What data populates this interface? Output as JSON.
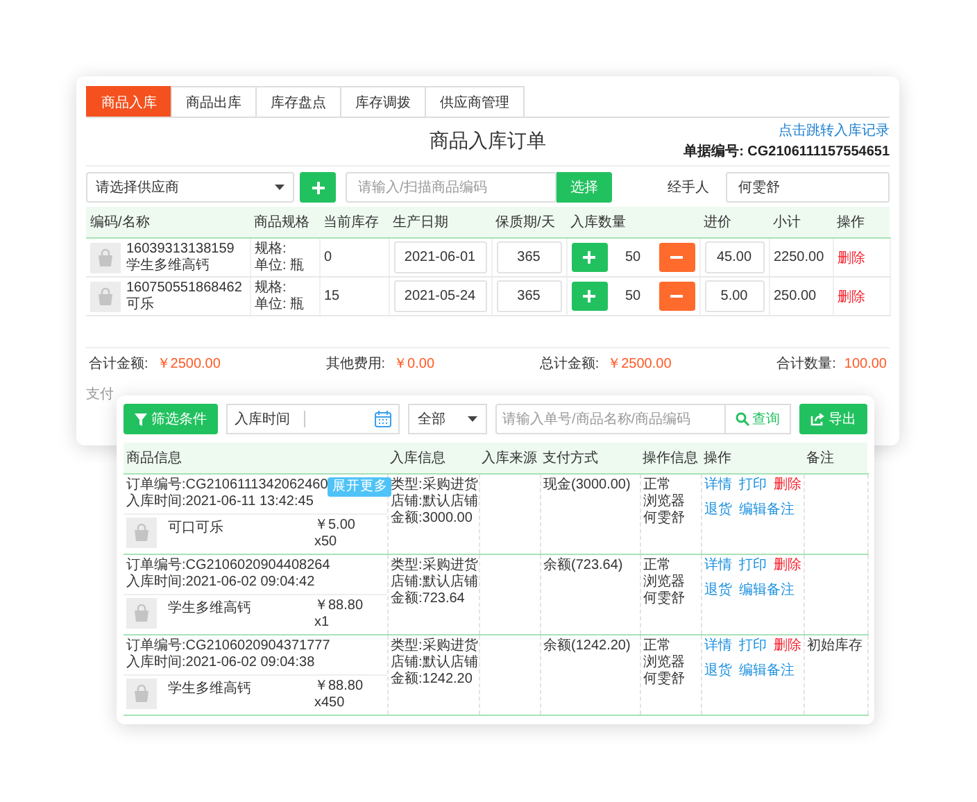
{
  "tabs": [
    {
      "label": "商品入库",
      "selected": true
    },
    {
      "label": "商品出库",
      "selected": false
    },
    {
      "label": "库存盘点",
      "selected": false
    },
    {
      "label": "库存调拨",
      "selected": false
    },
    {
      "label": "供应商管理",
      "selected": false
    }
  ],
  "form": {
    "title": "商品入库订单",
    "record_link": "点击跳转入库记录",
    "document_number": "单据编号: CG2106111157554651",
    "supplier_select": {
      "placeholder": "请选择供应商"
    },
    "code_input": {
      "placeholder": "请输入/扫描商品编码"
    },
    "select_button": "选择",
    "handler_label": "经手人",
    "handler_value": "何雯舒"
  },
  "items": {
    "columns": [
      "编码/名称",
      "商品规格",
      "当前库存",
      "生产日期",
      "保质期/天",
      "入库数量",
      "进价",
      "小计",
      "操作"
    ],
    "rows": [
      {
        "code": "16039313138159",
        "name": "学生多维高钙",
        "spec": "规格:",
        "unit": "单位: 瓶",
        "stock": "0",
        "date": "2021-06-01",
        "shelf_life": "365",
        "quantity": "50",
        "price": "45.00",
        "subtotal": "2250.00",
        "action": "删除"
      },
      {
        "code": "160750551868462",
        "name": "可乐",
        "spec": "规格:",
        "unit": "单位: 瓶",
        "stock": "15",
        "date": "2021-05-24",
        "shelf_life": "365",
        "quantity": "50",
        "price": "5.00",
        "subtotal": "250.00",
        "action": "删除"
      }
    ]
  },
  "summary": [
    {
      "label": "合计金额:",
      "value": "￥2500.00"
    },
    {
      "label": "其他费用:",
      "value": "￥0.00"
    },
    {
      "label": "总计金额:",
      "value": "￥2500.00"
    },
    {
      "label": "合计数量:",
      "value": "100.00"
    }
  ],
  "payment_label": "支付",
  "orders": {
    "filter_button": "筛选条件",
    "date_label": "入库时间",
    "status_select": "全部",
    "search": {
      "placeholder": "请输入单号/商品名称/商品编码"
    },
    "search_button": "查询",
    "export_button": "导出",
    "columns": [
      "商品信息",
      "入库信息",
      "入库来源",
      "支付方式",
      "操作信息",
      "操作",
      "备注"
    ],
    "rows": [
      {
        "order_no": "订单编号:CG2106111342062460",
        "time": "入库时间:2021-06-11 13:42:45",
        "badge": "展开更多",
        "product": "可口可乐",
        "price": "￥5.00",
        "qty": "x50",
        "info": [
          "类型:采购进货",
          "店铺:默认店铺",
          "金额:3000.00"
        ],
        "payment": "现金(3000.00)",
        "op_info": [
          "正常",
          "浏览器",
          "何雯舒"
        ],
        "actions": [
          [
            {
              "label": "详情",
              "kind": "link"
            },
            {
              "label": "打印",
              "kind": "link"
            },
            {
              "label": "删除",
              "kind": "danger"
            }
          ],
          [
            {
              "label": "退货",
              "kind": "link"
            },
            {
              "label": "编辑备注",
              "kind": "link"
            }
          ]
        ]
      },
      {
        "order_no": "订单编号:CG2106020904408264",
        "time": "入库时间:2021-06-02 09:04:42",
        "product": "学生多维高钙",
        "price": "￥88.80",
        "qty": "x1",
        "info": [
          "类型:采购进货",
          "店铺:默认店铺",
          "金额:723.64"
        ],
        "payment": "余额(723.64)",
        "op_info": [
          "正常",
          "浏览器",
          "何雯舒"
        ],
        "actions": [
          [
            {
              "label": "详情",
              "kind": "link"
            },
            {
              "label": "打印",
              "kind": "link"
            },
            {
              "label": "删除",
              "kind": "danger"
            }
          ],
          [
            {
              "label": "退货",
              "kind": "link"
            },
            {
              "label": "编辑备注",
              "kind": "link"
            }
          ]
        ]
      },
      {
        "order_no": "订单编号:CG2106020904371777",
        "time": "入库时间:2021-06-02 09:04:38",
        "product": "学生多维高钙",
        "price": "￥88.80",
        "qty": "x450",
        "info": [
          "类型:采购进货",
          "店铺:默认店铺",
          "金额:1242.20"
        ],
        "payment": "余额(1242.20)",
        "op_info": [
          "正常",
          "浏览器",
          "何雯舒"
        ],
        "actions": [
          [
            {
              "label": "详情",
              "kind": "link"
            },
            {
              "label": "打印",
              "kind": "link"
            },
            {
              "label": "删除",
              "kind": "danger"
            }
          ],
          [
            {
              "label": "退货",
              "kind": "link"
            },
            {
              "label": "编辑备注",
              "kind": "link"
            }
          ]
        ],
        "remark": "初始库存"
      }
    ]
  }
}
